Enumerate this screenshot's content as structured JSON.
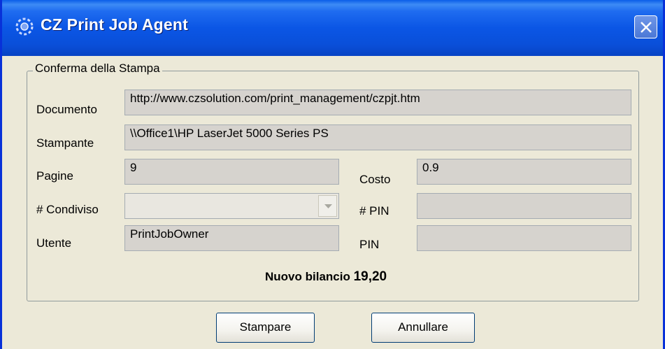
{
  "window": {
    "title": "CZ Print Job Agent",
    "icon": "cz-logo-icon",
    "close_icon": "close-icon"
  },
  "group": {
    "legend": "Conferma della Stampa"
  },
  "fields": {
    "documento": {
      "label": "Documento",
      "value": "http://www.czsolution.com/print_management/czpjt.htm"
    },
    "stampante": {
      "label": "Stampante",
      "value": "\\\\Office1\\HP LaserJet 5000 Series PS"
    },
    "pagine": {
      "label": "Pagine",
      "value": "9"
    },
    "costo": {
      "label": "Costo",
      "value": "0.9"
    },
    "condiviso": {
      "label": "# Condiviso",
      "value": ""
    },
    "pin_num": {
      "label": "# PIN",
      "value": ""
    },
    "utente": {
      "label": "Utente",
      "value": "PrintJobOwner"
    },
    "pin": {
      "label": "PIN",
      "value": ""
    }
  },
  "balance": {
    "label": "Nuovo bilancio",
    "value": "19,20"
  },
  "buttons": {
    "print": "Stampare",
    "cancel": "Annullare"
  },
  "colors": {
    "titlebar": "#0a4fd9",
    "dialog_bg": "#ece9d8",
    "field_bg": "#d6d3ce"
  }
}
